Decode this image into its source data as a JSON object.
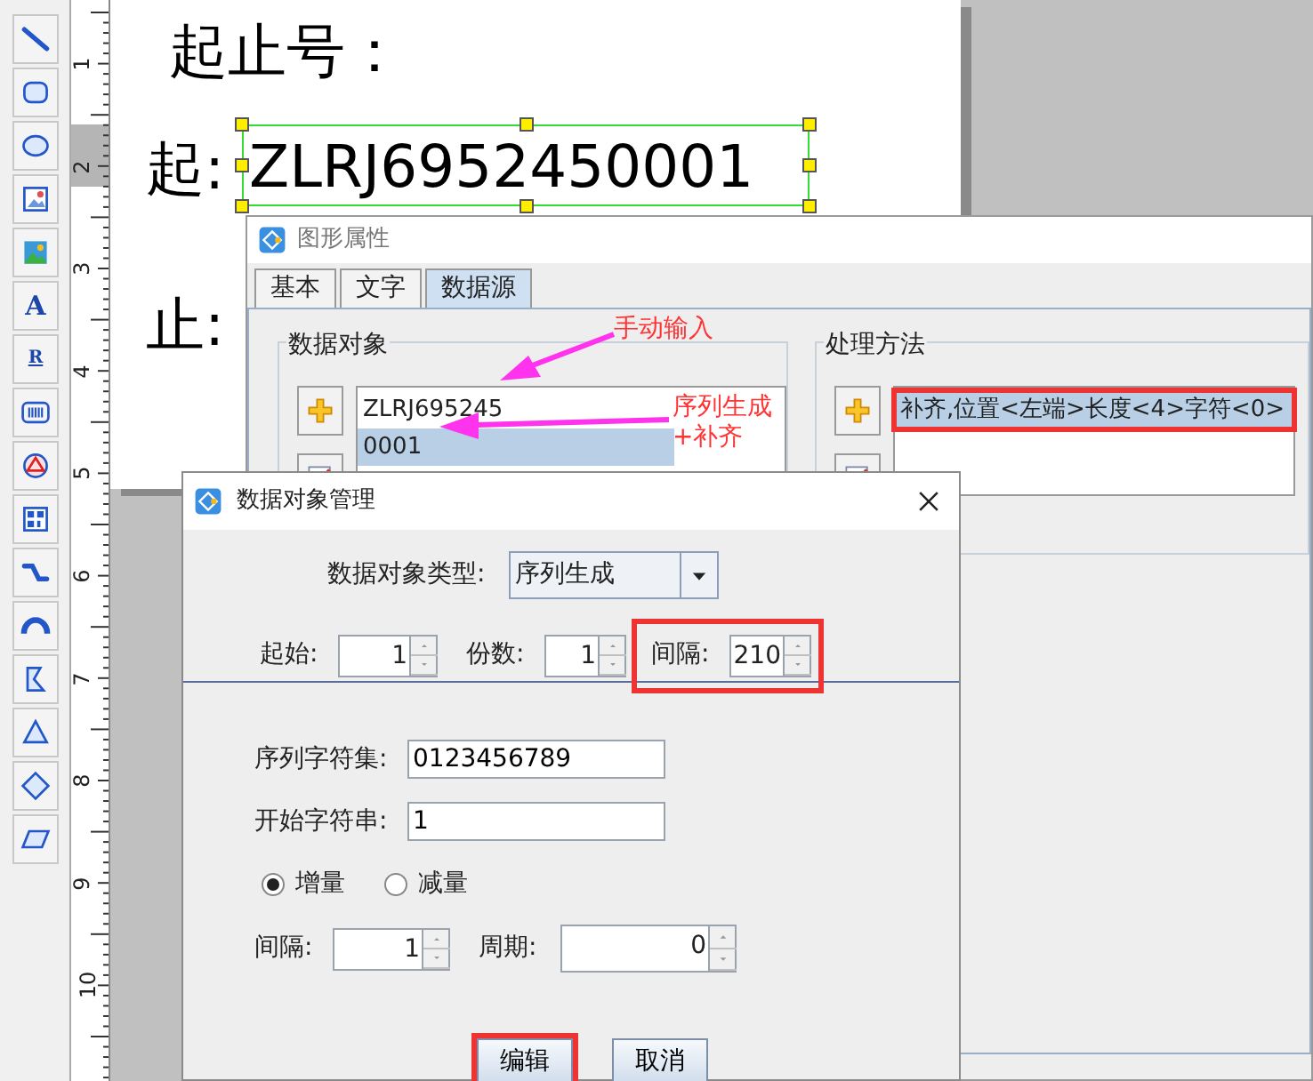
{
  "toolbar": {
    "tools": [
      {
        "kind": "line"
      },
      {
        "kind": "rounded_rect"
      },
      {
        "kind": "ellipse"
      },
      {
        "kind": "image"
      },
      {
        "kind": "picture"
      },
      {
        "kind": "text",
        "glyph": "A"
      },
      {
        "kind": "rich_text",
        "glyph": "R"
      },
      {
        "kind": "barcode"
      },
      {
        "kind": "shape"
      },
      {
        "kind": "qrcode"
      },
      {
        "kind": "curve"
      },
      {
        "kind": "arc"
      },
      {
        "kind": "polygon"
      },
      {
        "kind": "triangle"
      },
      {
        "kind": "diamond"
      },
      {
        "kind": "parallelogram"
      }
    ]
  },
  "ruler": {
    "numbers": [
      "1",
      "2",
      "3",
      "4",
      "5",
      "6",
      "7",
      "8",
      "9",
      "10"
    ]
  },
  "canvas": {
    "heading": "起止号：",
    "start_label": "起:",
    "start_value": {
      "text": "ZLRJ6952450001",
      "selected": true
    },
    "end_label": "止:"
  },
  "properties_window": {
    "title": "图形属性",
    "tabs": [
      {
        "label": "基本",
        "selected": false
      },
      {
        "label": "文字",
        "selected": false
      },
      {
        "label": "数据源",
        "selected": true
      }
    ],
    "data_objects": {
      "title": "数据对象",
      "items": [
        {
          "text": "ZLRJ695245",
          "selected": false
        },
        {
          "text": "0001",
          "selected": true
        }
      ]
    },
    "processing": {
      "title": "处理方法",
      "items": [
        {
          "text": "补齐,位置<左端>长度<4>字符<0>",
          "selected": true,
          "highlighted": true
        }
      ]
    }
  },
  "annotations": [
    {
      "lines": [
        "手动输入"
      ]
    },
    {
      "lines": [
        "序列生成",
        "+补齐"
      ]
    }
  ],
  "manager_window": {
    "title": "数据对象管理",
    "type_label": "数据对象类型:",
    "type_value": "序列生成",
    "start": {
      "label": "起始:",
      "value": "1",
      "highlighted": false
    },
    "copies": {
      "label": "份数:",
      "value": "1",
      "highlighted": false
    },
    "gap": {
      "label": "间隔:",
      "value": "210",
      "highlighted": true
    },
    "charset": {
      "label": "序列字符集:",
      "value": "0123456789"
    },
    "start_string": {
      "label": "开始字符串:",
      "value": "1"
    },
    "direction": [
      {
        "label": "增量",
        "selected": true
      },
      {
        "label": "减量",
        "selected": false
      }
    ],
    "step": {
      "label": "间隔:",
      "value": "1"
    },
    "period": {
      "label": "周期:",
      "value": "0"
    },
    "buttons": [
      {
        "label": "编辑",
        "highlighted": true
      },
      {
        "label": "取消",
        "highlighted": false
      }
    ]
  }
}
